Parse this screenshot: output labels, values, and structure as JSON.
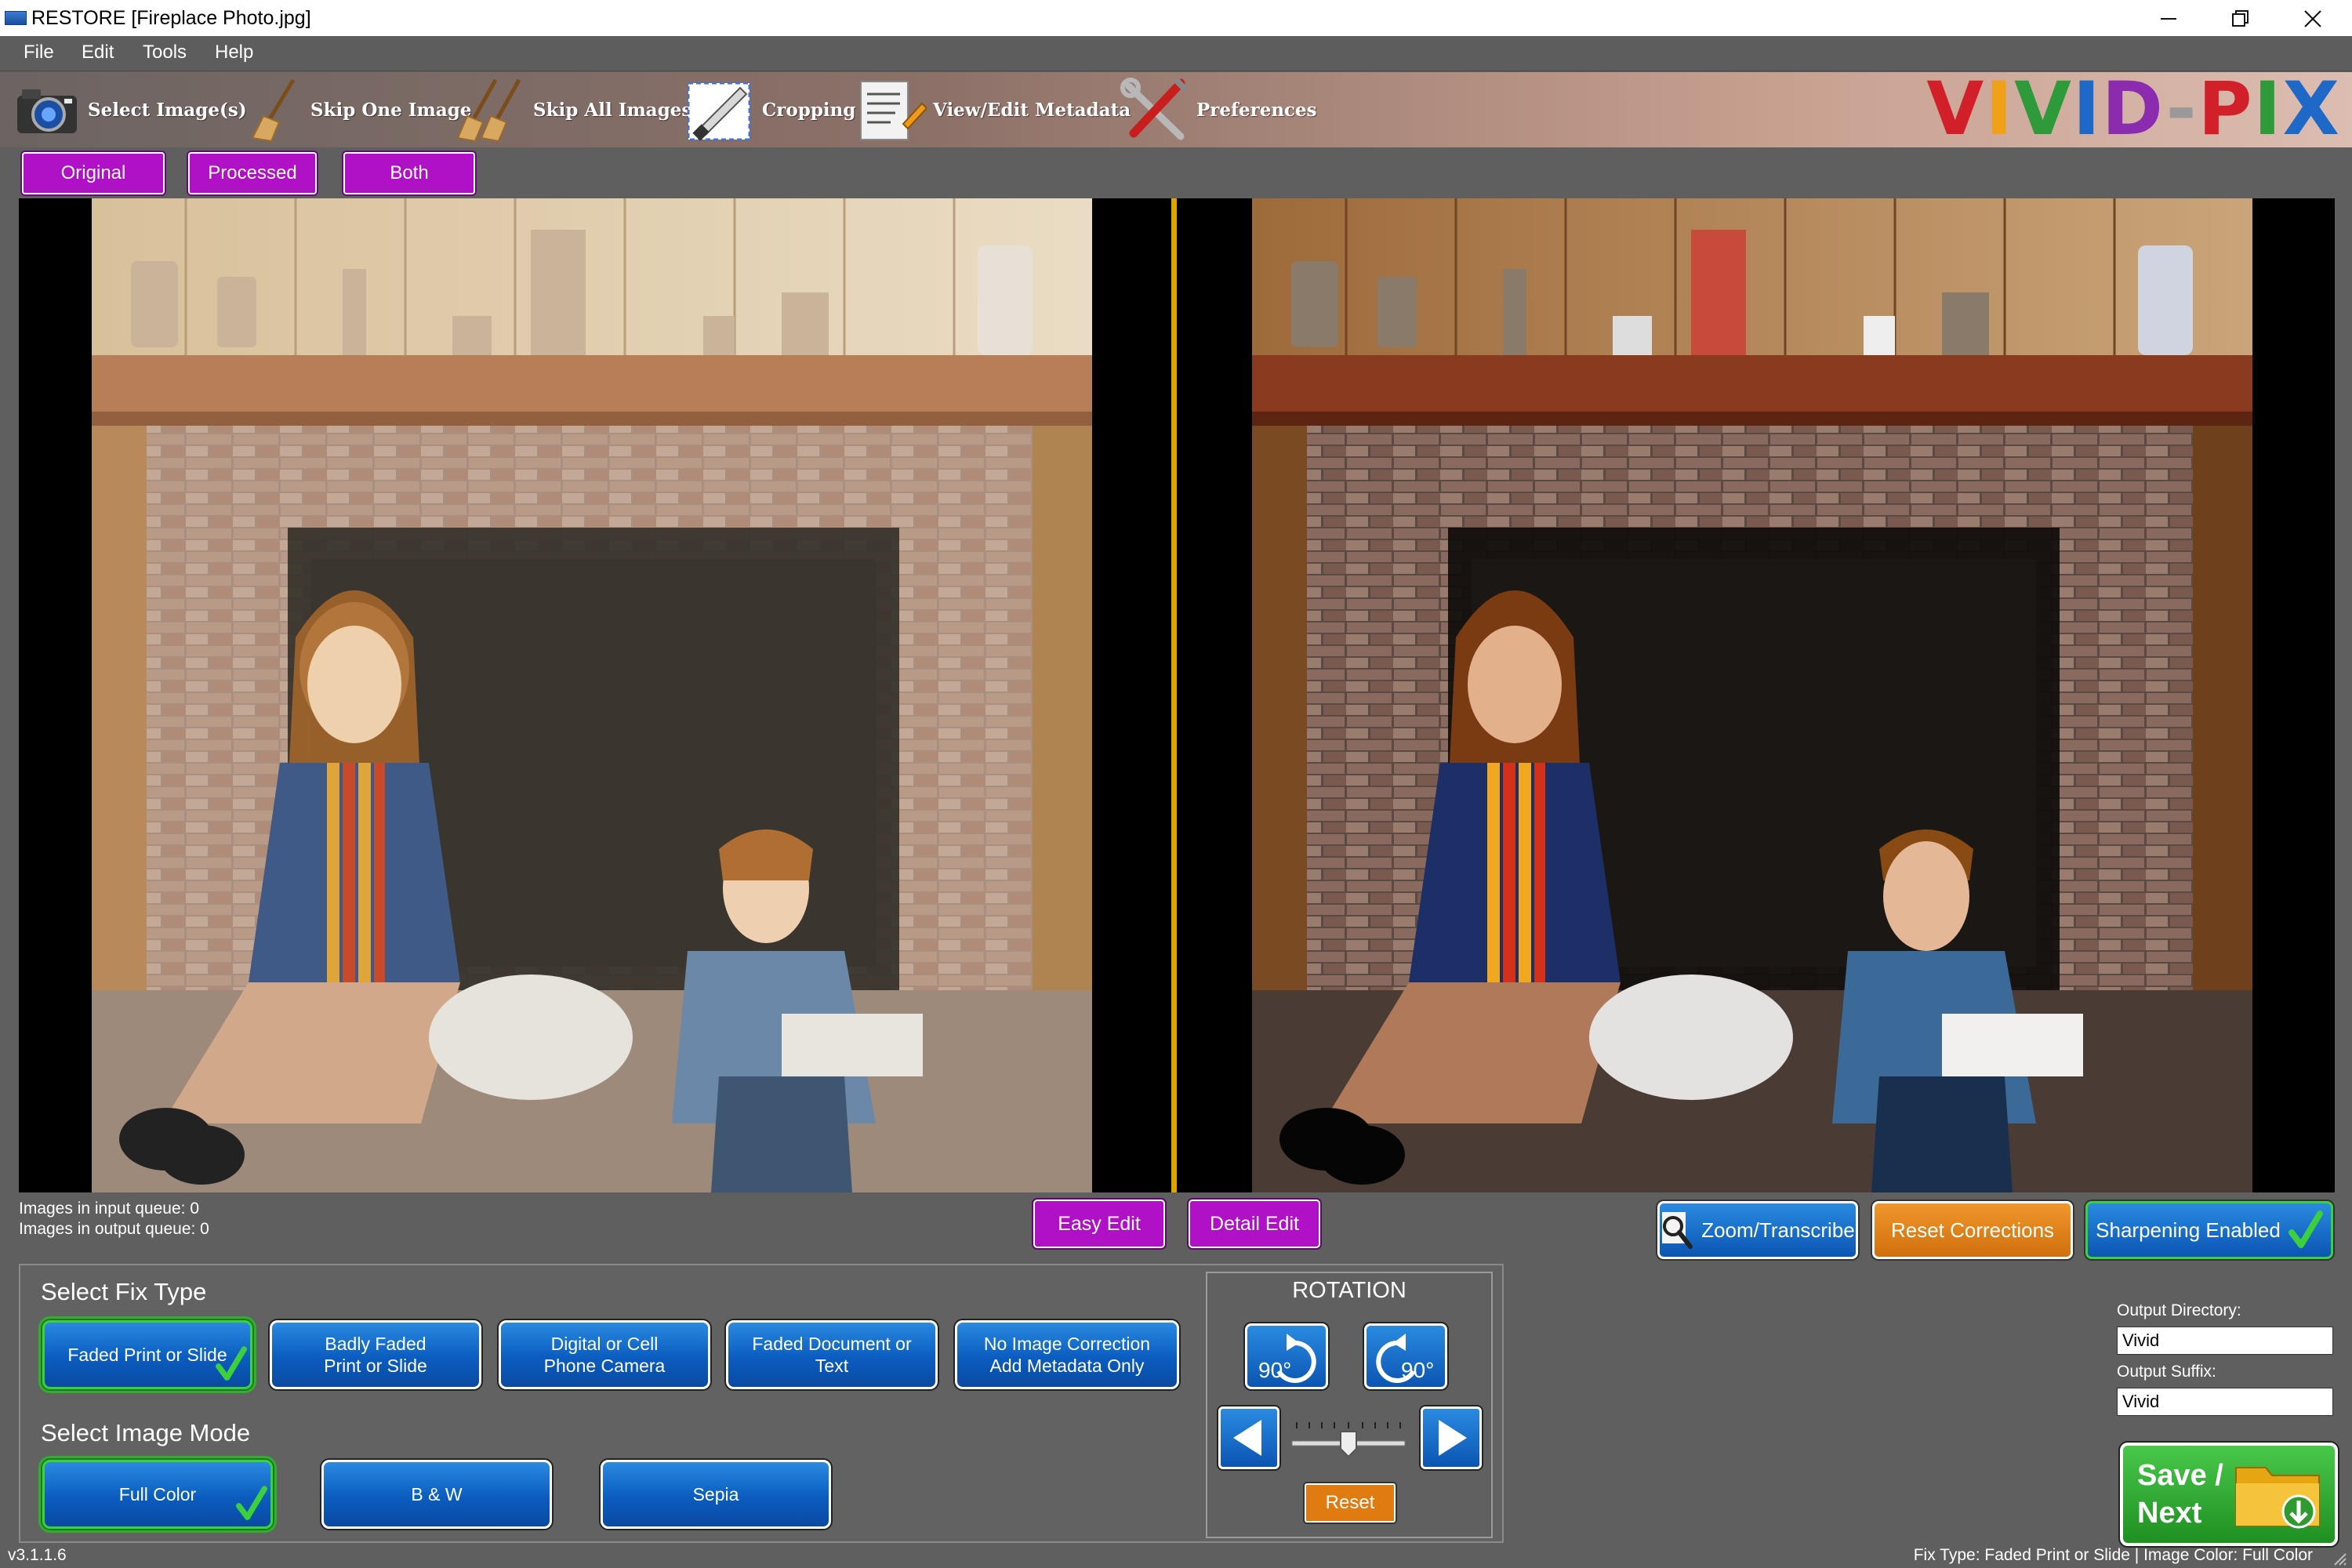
{
  "window": {
    "title": "RESTORE  [Fireplace Photo.jpg]",
    "controls": [
      "minimize",
      "restore",
      "close"
    ]
  },
  "menu": [
    "File",
    "Edit",
    "Tools",
    "Help"
  ],
  "toolbar": {
    "items": [
      {
        "label": "Select Image(s)",
        "icon": "camera-icon"
      },
      {
        "label": "Skip One Image",
        "icon": "broom-icon"
      },
      {
        "label": "Skip All Images",
        "icon": "brooms-icon"
      },
      {
        "label": "Cropping",
        "icon": "crop-knife-icon"
      },
      {
        "label": "View/Edit Metadata",
        "icon": "document-pencil-icon"
      },
      {
        "label": "Preferences",
        "icon": "tools-icon"
      }
    ],
    "logo": "VIVID-PIX"
  },
  "view_modes": {
    "options": [
      "Original",
      "Processed",
      "Both"
    ],
    "selected": "Both"
  },
  "viewer": {
    "left_panel": "Original",
    "right_panel": "Processed",
    "divider_color": "#e0a300"
  },
  "queue": {
    "input": "Images in input queue:  0",
    "output": "Images in output queue: 0"
  },
  "edit_modes": {
    "easy": "Easy Edit",
    "detail": "Detail Edit"
  },
  "actions": {
    "zoom": "Zoom/Transcribe",
    "reset": "Reset Corrections",
    "sharpen": "Sharpening Enabled"
  },
  "fix_type": {
    "title": "Select Fix Type",
    "options": [
      {
        "line1": "Faded Print or Slide",
        "line2": "",
        "selected": true
      },
      {
        "line1": "Badly Faded",
        "line2": "Print or Slide",
        "selected": false
      },
      {
        "line1": "Digital or Cell",
        "line2": "Phone Camera",
        "selected": false
      },
      {
        "line1": "Faded Document or",
        "line2": "Text",
        "selected": false
      },
      {
        "line1": "No Image Correction",
        "line2": "Add Metadata Only",
        "selected": false
      }
    ]
  },
  "image_mode": {
    "title": "Select Image Mode",
    "options": [
      {
        "label": "Full Color",
        "selected": true
      },
      {
        "label": "B & W",
        "selected": false
      },
      {
        "label": "Sepia",
        "selected": false
      }
    ]
  },
  "rotation": {
    "title": "ROTATION",
    "ccw": "90°",
    "cw": "90°",
    "fine_level": 0.5,
    "reset": "Reset"
  },
  "output": {
    "directory_label": "Output Directory:",
    "directory": "Vivid",
    "suffix_label": "Output Suffix:",
    "suffix": "Vivid"
  },
  "save": {
    "line1": "Save /",
    "line2": "Next"
  },
  "status": {
    "version": "v3.1.1.6",
    "fix_summary": "Fix Type:  Faded Print or Slide | Image Color: Full Color"
  },
  "colors": {
    "purple": "#b010c6",
    "blue": "#0b5cbf",
    "orange": "#e07b12",
    "green": "#2fae2f",
    "selected_border": "#3cd13c"
  }
}
